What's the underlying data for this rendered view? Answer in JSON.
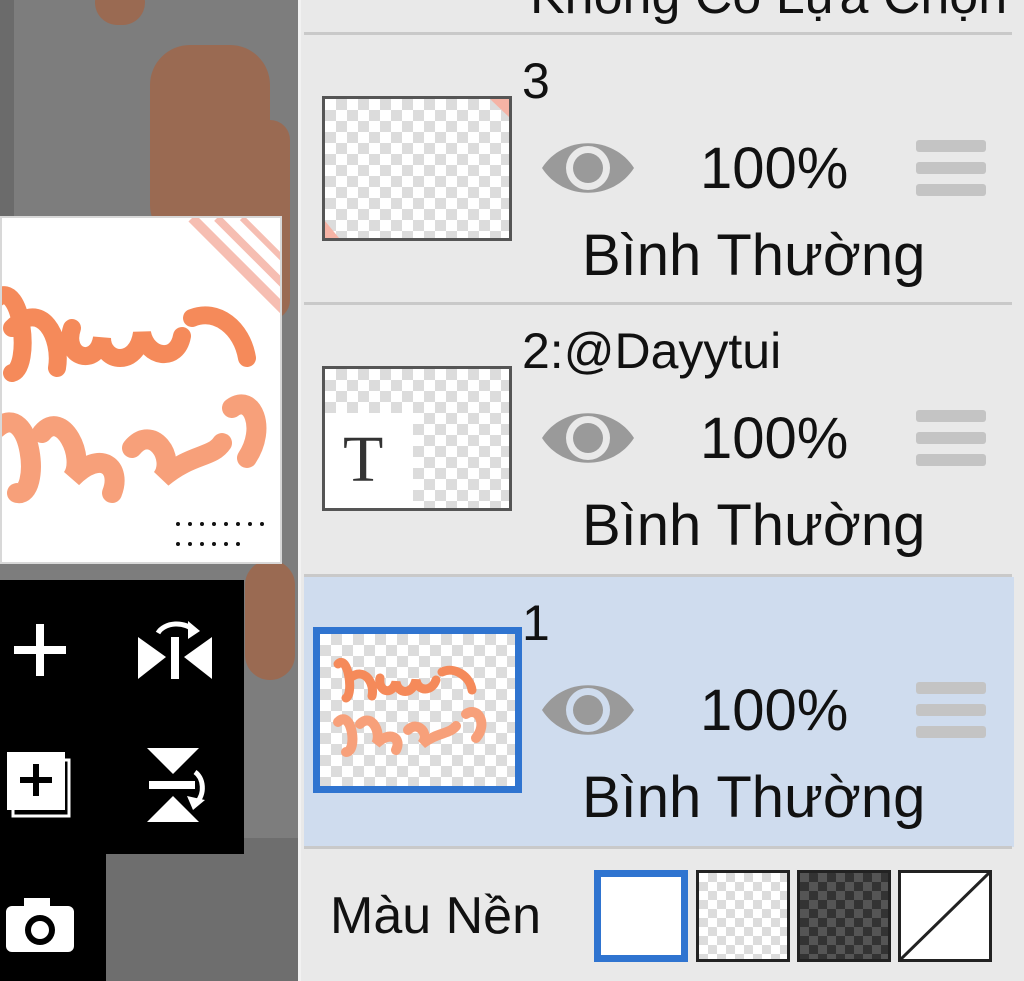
{
  "layers_panel": {
    "top_partial_text": "Không Có Lựa Chọn",
    "layers": [
      {
        "name": "3",
        "opacity": "100%",
        "blend_mode": "Bình Thường",
        "visible": true,
        "selected": false
      },
      {
        "name": "2:@Dayytui",
        "opacity": "100%",
        "blend_mode": "Bình Thường",
        "visible": true,
        "selected": false,
        "thumb_text": "T"
      },
      {
        "name": "1",
        "opacity": "100%",
        "blend_mode": "Bình Thường",
        "visible": true,
        "selected": true
      }
    ],
    "background": {
      "label": "Màu Nền",
      "options": [
        "white",
        "transparent-light",
        "transparent-dark",
        "none"
      ],
      "selected": "white"
    }
  },
  "tools": {
    "icons": [
      "add-layer-icon",
      "flip-horizontal-icon",
      "duplicate-layer-icon",
      "flip-vertical-icon",
      "camera-icon"
    ]
  },
  "colors": {
    "accent": "#2f74d0",
    "selected_row": "#cfdcee",
    "panel_bg": "#e9e9e9",
    "artwork_orange": "#f58a5a"
  }
}
